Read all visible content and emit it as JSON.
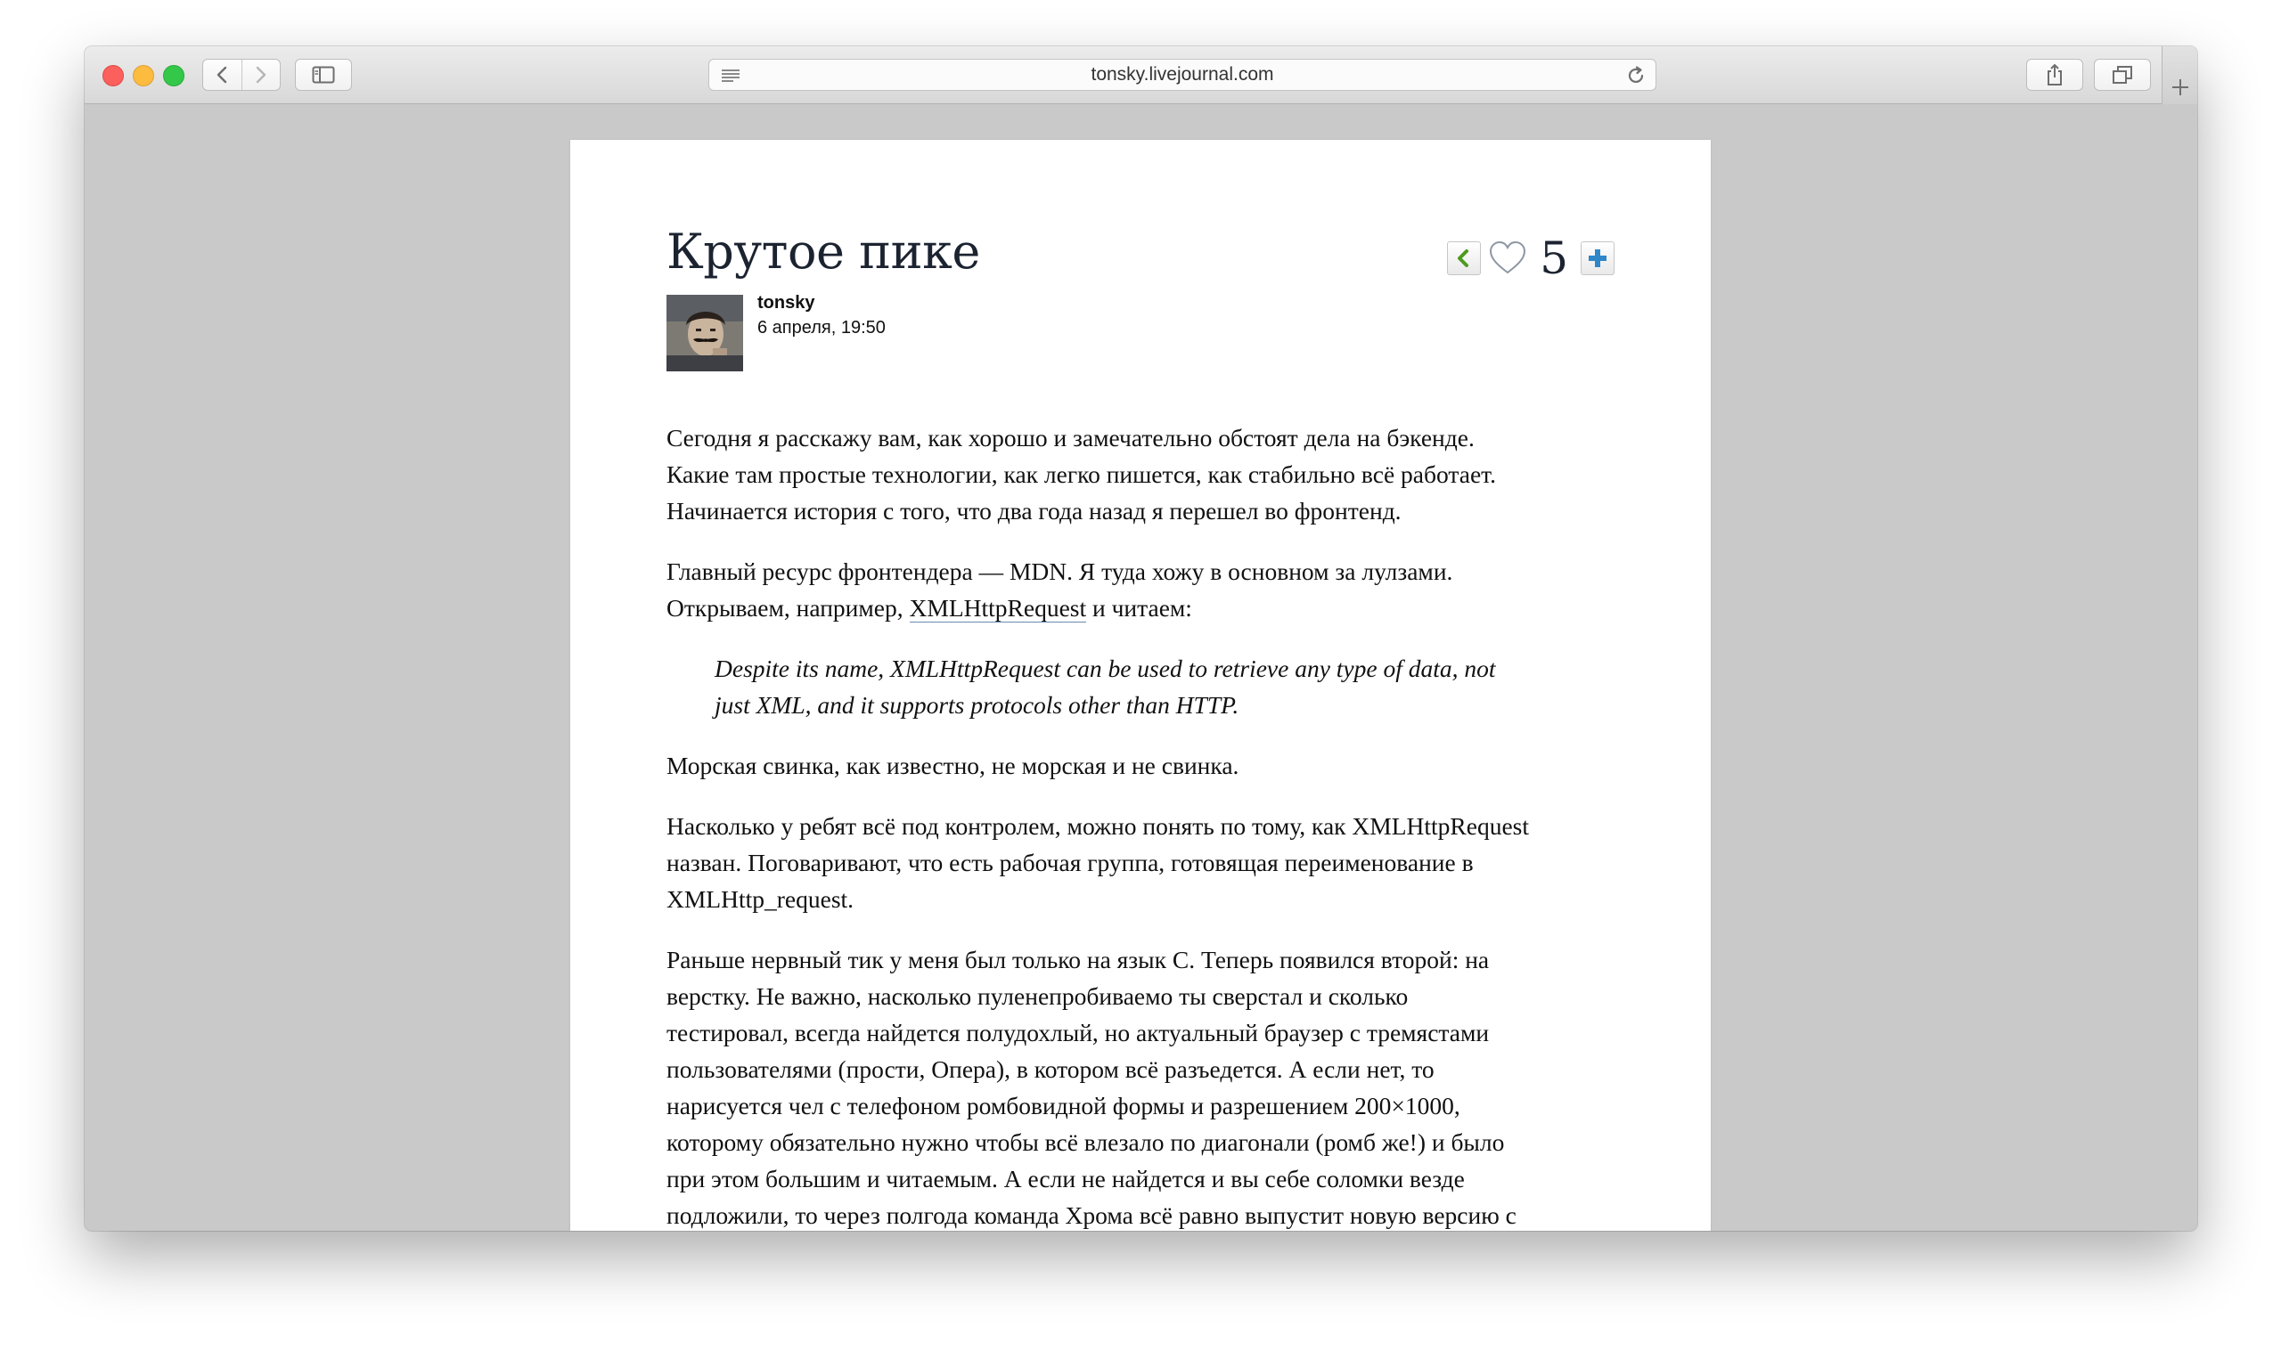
{
  "browser": {
    "url": "tonsky.livejournal.com"
  },
  "post": {
    "title": "Крутое пике",
    "rating_count": "5",
    "author": "tonsky",
    "date": "6 апреля, 19:50",
    "p1": "Сегодня я расскажу вам, как хорошо и замечательно обстоят дела на бэкенде.\nКакие там простые технологии, как легко пишется, как стабильно всё работает.\nНачинается история с того, что два года назад я перешел во фронтенд.",
    "p2_before": "Главный ресурс фронтендера — MDN. Я туда хожу в основном за лулзами.\nОткрываем, например, ",
    "p2_link": "XMLHttpRequest",
    "p2_after": " и читаем:",
    "quote": "Despite its name, XMLHttpRequest can be used to retrieve any type of data, not\njust XML, and it supports protocols other than HTTP.",
    "p3": "Морская свинка, как известно, не морская и не свинка.",
    "p4": "Насколько у ребят всё под контролем, можно понять по тому, как XMLHttpRequest\nназван. Поговаривают, что есть рабочая группа, готовящая переименование в\nXMLHttp_request.",
    "p5": "Раньше нервный тик у меня был только на язык C. Теперь появился второй: на\nверстку. Не важно, насколько пуленепробиваемо ты сверстал и сколько\nтестировал, всегда найдется полудохлый, но актуальный браузер с тремястами\nпользователями (прости, Опера), в котором всё разъедется. А если нет, то\nнарисуется чел с телефоном ромбовидной формы и разрешением 200×1000,\nкоторому обязательно нужно чтобы всё влезало по диагонали (ромб же!) и было\nпри этом большим и читаемым. А если не найдется и вы себе соломки везде\nподложили, то через полгода команда Хрома всё равно выпустит новую версию с"
  },
  "icons": {
    "window_close": "close-dot",
    "window_minimize": "minimize-dot",
    "window_maximize": "maximize-dot",
    "back": "chevron-left-icon",
    "forward": "chevron-right-icon",
    "sidebar": "sidebar-icon",
    "reader": "reader-lines-icon",
    "reload": "reload-icon",
    "share": "share-icon",
    "tabs": "tabs-overview-icon",
    "new_tab": "plus-icon",
    "prev_post": "green-arrow-left-icon",
    "like": "heart-icon",
    "add": "blue-plus-icon"
  },
  "colors": {
    "close": "#fc605c",
    "minimize": "#fdbc40",
    "maximize": "#34c84a",
    "page_background": "#c9c9c9",
    "link_underline": "#6b8ab0",
    "prev_arrow": "#4e9a1e",
    "add_plus": "#2f86c9"
  }
}
